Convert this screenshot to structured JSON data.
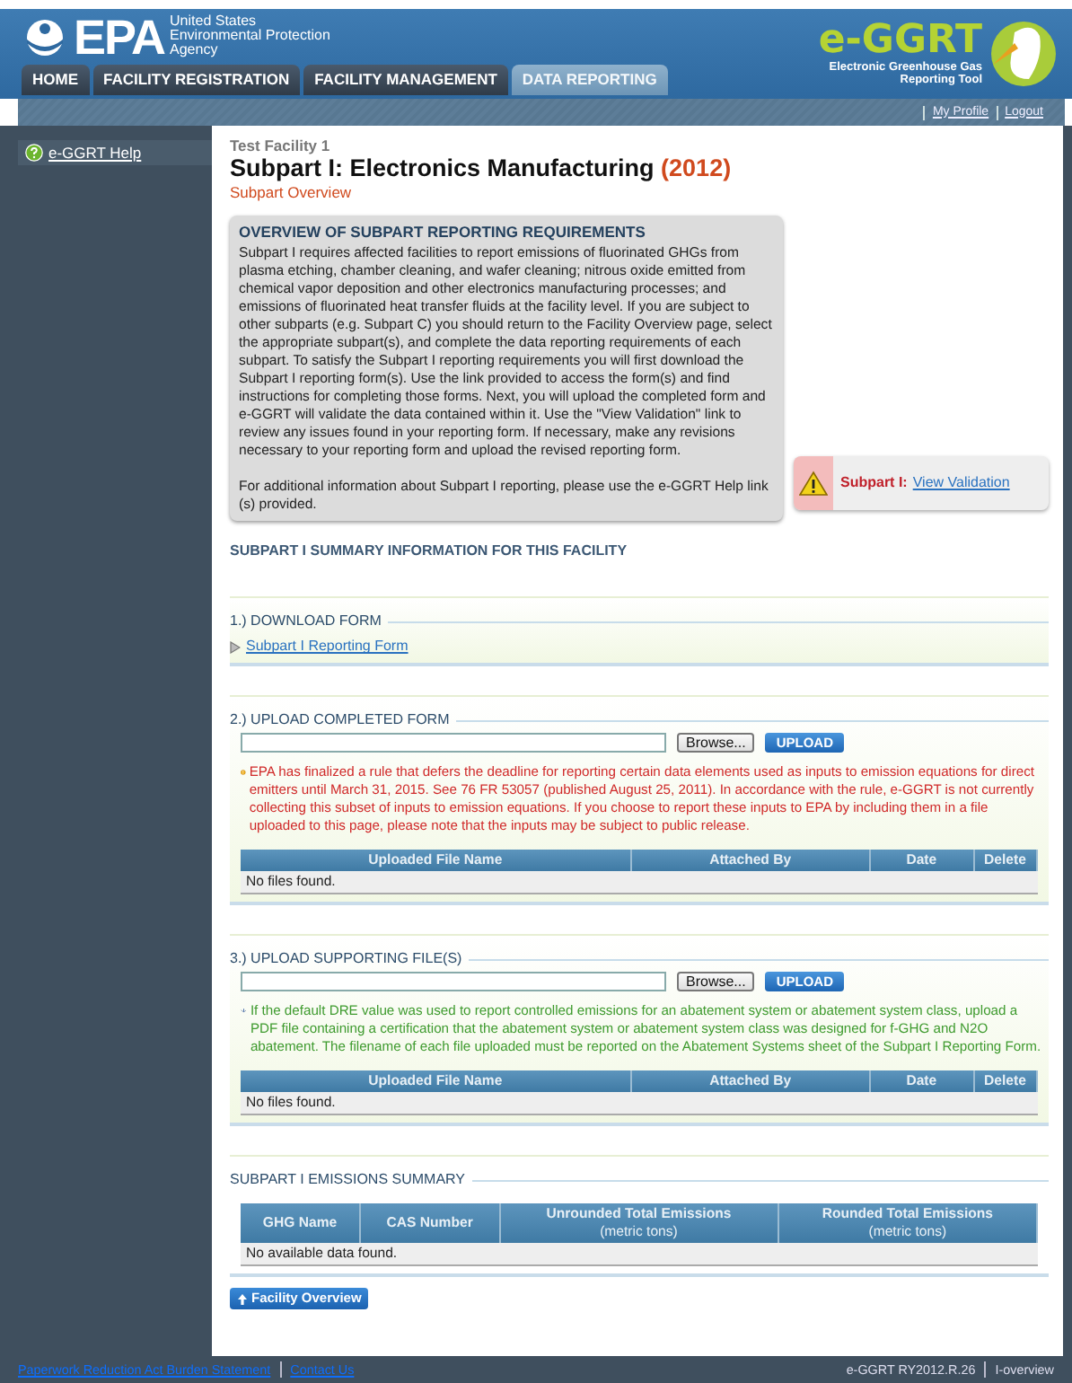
{
  "header": {
    "agency_logo": "EPA",
    "agency_name": [
      "United States",
      "Environmental Protection",
      "Agency"
    ],
    "app_logo": "e-GGRT",
    "app_subtitle": [
      "Electronic Greenhouse Gas",
      "Reporting Tool"
    ]
  },
  "tabs": [
    {
      "label": "HOME",
      "selected": false
    },
    {
      "label": "FACILITY REGISTRATION",
      "selected": false
    },
    {
      "label": "FACILITY MANAGEMENT",
      "selected": false
    },
    {
      "label": "DATA REPORTING",
      "selected": true
    }
  ],
  "user_links": [
    "My Profile",
    "Logout"
  ],
  "sidebar": {
    "items": [
      {
        "label": "e-GGRT Help"
      }
    ]
  },
  "page": {
    "facility": "Test Facility 1",
    "title": "Subpart I: Electronics Manufacturing",
    "year": "(2012)",
    "subtitle": "Subpart Overview"
  },
  "overview": {
    "heading": "OVERVIEW OF SUBPART REPORTING REQUIREMENTS",
    "paragraphs": [
      "Subpart I requires affected facilities to report emissions of fluorinated GHGs from plasma etching, chamber cleaning, and wafer cleaning; nitrous oxide emitted from chemical vapor deposition and other electronics manufacturing processes; and emissions of fluorinated heat transfer fluids at the facility level. If you are subject to other subparts (e.g. Subpart C) you should return to the Facility Overview page, select the appropriate subpart(s), and complete the data reporting requirements of each subpart. To satisfy the Subpart I reporting requirements you will first download the Subpart I reporting form(s). Use the link provided to access the form(s) and find instructions for completing those forms. Next, you will upload the completed form and e-GGRT will validate the data contained within it. Use the \"View Validation\" link to review any issues found in your reporting form. If necessary, make any revisions necessary to your reporting form and upload the revised reporting form.",
      "For additional information about Subpart I reporting, please use the e-GGRT Help link (s) provided."
    ]
  },
  "validation": {
    "label": "Subpart I:",
    "link": "View Validation"
  },
  "summary_heading": "SUBPART I SUMMARY INFORMATION FOR THIS FACILITY",
  "sections": [
    {
      "kind": "download",
      "title": "1.) DOWNLOAD FORM",
      "link": "Subpart I Reporting Form"
    },
    {
      "kind": "upload",
      "title": "2.) UPLOAD COMPLETED FORM",
      "browse": "Browse...",
      "upload": "UPLOAD",
      "notice": {
        "kind": "warning",
        "text": "EPA has finalized a rule that defers the deadline for reporting certain data elements used as inputs to emission equations for direct emitters until March 31, 2015. See 76 FR 53057 (published August 25, 2011). In accordance with the rule, e-GGRT is not currently collecting this subset of inputs to emission equations. If you choose to report these inputs to EPA by including them in a file uploaded to this page, please note that the inputs may be subject to public release."
      },
      "columns": [
        "Uploaded File Name",
        "Attached By",
        "Date",
        "Delete"
      ],
      "empty": "No files found."
    },
    {
      "kind": "upload",
      "title": "3.) UPLOAD SUPPORTING FILE(S)",
      "browse": "Browse...",
      "upload": "UPLOAD",
      "notice": {
        "kind": "info",
        "text": "If the default DRE value was used to report controlled emissions for an abatement system or abatement system class, upload a PDF file containing a certification that the abatement system or abatement system class was designed for f-GHG and N2O abatement. The filename of each file uploaded must be reported on the Abatement Systems sheet of the Subpart I Reporting Form."
      },
      "columns": [
        "Uploaded File Name",
        "Attached By",
        "Date",
        "Delete"
      ],
      "empty": "No files found."
    }
  ],
  "emissions": {
    "title": "SUBPART I EMISSIONS SUMMARY",
    "columns": [
      {
        "name": "GHG Name"
      },
      {
        "name": "CAS Number"
      },
      {
        "name": "Unrounded Total Emissions",
        "unit": "(metric tons)"
      },
      {
        "name": "Rounded Total Emissions",
        "unit": "(metric tons)"
      }
    ],
    "empty": "No available data found."
  },
  "back_button": "Facility Overview",
  "footer": {
    "left": [
      "Paperwork Reduction Act Burden Statement",
      "Contact Us"
    ],
    "right": [
      "e-GGRT RY2012.R.26",
      "I-overview"
    ]
  }
}
